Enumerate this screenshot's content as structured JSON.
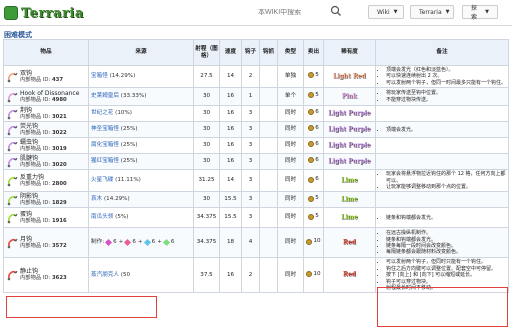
{
  "header": {
    "logo_text": "Terraria",
    "search_placeholder": "本WIKI中搜索",
    "menus": [
      {
        "label": "Wiki"
      },
      {
        "label": "Terraria"
      },
      {
        "label": "探索"
      }
    ]
  },
  "section": {
    "title": "困难模式"
  },
  "table": {
    "columns": [
      "物品",
      "来源",
      "射程（图格）",
      "速度",
      "钩子",
      "钩抓",
      "类型",
      "卖出",
      "稀有度",
      "备注"
    ],
    "id_prefix": "内部物品 ID:",
    "rows": [
      {
        "name": "双钩",
        "id": "437",
        "source": "宝箱怪",
        "pct": "(14.29%)",
        "range": "27.5",
        "speed": "14",
        "hooks": "2",
        "lat": "",
        "type": "单独",
        "sell": "5",
        "rarity": "Light Red",
        "rarity_color": "#f2a07a",
        "notes": [
          "顶端会发光（红色和淡蓝色）。",
          "可以快速连续射出 2 次。",
          "可以发射两个钩子，但同一时间最多只能有一个钩住。"
        ]
      },
      {
        "name": "Hook of Dissonance",
        "id": "4980",
        "source": "史莱姆皇后",
        "pct": "(33.33%)",
        "range": "30",
        "speed": "16",
        "hooks": "1",
        "lat": "",
        "type": "单个",
        "sell": "5",
        "rarity": "Pink",
        "rarity_color": "#e39dd8",
        "notes": [
          "将玩家传送至钩中位置。",
          "不能穿过物块传送。"
        ]
      },
      {
        "name": "荆钩",
        "id": "3021",
        "source": "世纪之花",
        "pct": "(10%)",
        "range": "30",
        "speed": "16",
        "hooks": "3",
        "lat": "",
        "type": "同时",
        "sell": "6",
        "rarity": "Light Purple",
        "rarity_color": "#c58fe6",
        "notes": []
      },
      {
        "name": "荧光钩",
        "id": "3022",
        "source": "神圣宝箱怪",
        "pct": "(25%)",
        "range": "30",
        "speed": "16",
        "hooks": "3",
        "lat": "",
        "type": "同时",
        "sell": "6",
        "rarity": "Light Purple",
        "rarity_color": "#c58fe6",
        "notes": [
          "顶端会发光。"
        ]
      },
      {
        "name": "蠕虫钩",
        "id": "3019",
        "source": "腐化宝箱怪",
        "pct": "(25%)",
        "range": "30",
        "speed": "16",
        "hooks": "3",
        "lat": "",
        "type": "同时",
        "sell": "6",
        "rarity": "Light Purple",
        "rarity_color": "#c58fe6",
        "notes": []
      },
      {
        "name": "肌腱钩",
        "id": "3020",
        "source": "猩红宝箱怪",
        "pct": "(25%)",
        "range": "30",
        "speed": "16",
        "hooks": "3",
        "lat": "",
        "type": "同时",
        "sell": "6",
        "rarity": "Light Purple",
        "rarity_color": "#c58fe6",
        "notes": []
      },
      {
        "name": "反重力钩",
        "id": "2800",
        "source": "火星飞碟",
        "pct": "(11.11%)",
        "range": "31.25",
        "speed": "14",
        "hooks": "3",
        "lat": "",
        "type": "同时",
        "sell": "6",
        "rarity": "Lime",
        "rarity_color": "#9edc3a",
        "notes": [
          "玩家会将悬浮物拉近钩住的那个 12 格，任何方向上都可以。",
          "让玩家能够调整移动到那个点的位置。"
        ]
      },
      {
        "name": "阴影钩",
        "id": "1829",
        "source": "哀木",
        "pct": "(14.29%)",
        "range": "30",
        "speed": "15.5",
        "hooks": "3",
        "lat": "",
        "type": "同时",
        "sell": "5",
        "rarity": "Lime",
        "rarity_color": "#9edc3a",
        "notes": []
      },
      {
        "name": "蛋钩",
        "id": "1916",
        "source": "南瓜头领",
        "pct": "(5%)",
        "range": "34.375",
        "speed": "15.5",
        "hooks": "3",
        "lat": "",
        "type": "同时",
        "sell": "5",
        "rarity": "Lime",
        "rarity_color": "#9edc3a",
        "notes": [
          "链条和钩端都会发光。"
        ]
      },
      {
        "name": "月钩",
        "id": "3572",
        "source": "制作:",
        "pct": "",
        "range": "34.375",
        "speed": "18",
        "hooks": "4",
        "lat": "",
        "type": "同时",
        "sell": "10",
        "rarity": "Red",
        "rarity_color": "#e84a3a",
        "craft": {
          "amounts": [
            "6",
            "6",
            "6",
            "6"
          ],
          "station": "远古操纵机"
        },
        "notes": [
          "在远古操纵机制作。",
          "链条和钩端都会发光。",
          "链条每隔一段时间会改变颜色。",
          "每隔链条都会跟随材料改变颜色。"
        ]
      },
      {
        "name": "静止钩",
        "id": "3623",
        "source": "蒸汽朋克人",
        "pct": "(50",
        "range": "37.5",
        "speed": "16",
        "hooks": "2",
        "lat": "",
        "type": "同时",
        "sell": "10",
        "rarity": "Red",
        "rarity_color": "#e84a3a",
        "notes": [
          "可以发射两个钩子，但同时只能有一个钩住。",
          "钩住之后方向键可以调整位置。配套空中可停留。",
          "按下 [向上] 和 [向下] 可以缩短或延长。",
          "钩子可以穿过物块。",
          "射程最长时间不移动。"
        ]
      }
    ]
  },
  "colors": {
    "link": "#2a63b8",
    "header_bg": "#eaf1f9",
    "section_title": "#2c5a99",
    "highlight": "#e0413a"
  }
}
